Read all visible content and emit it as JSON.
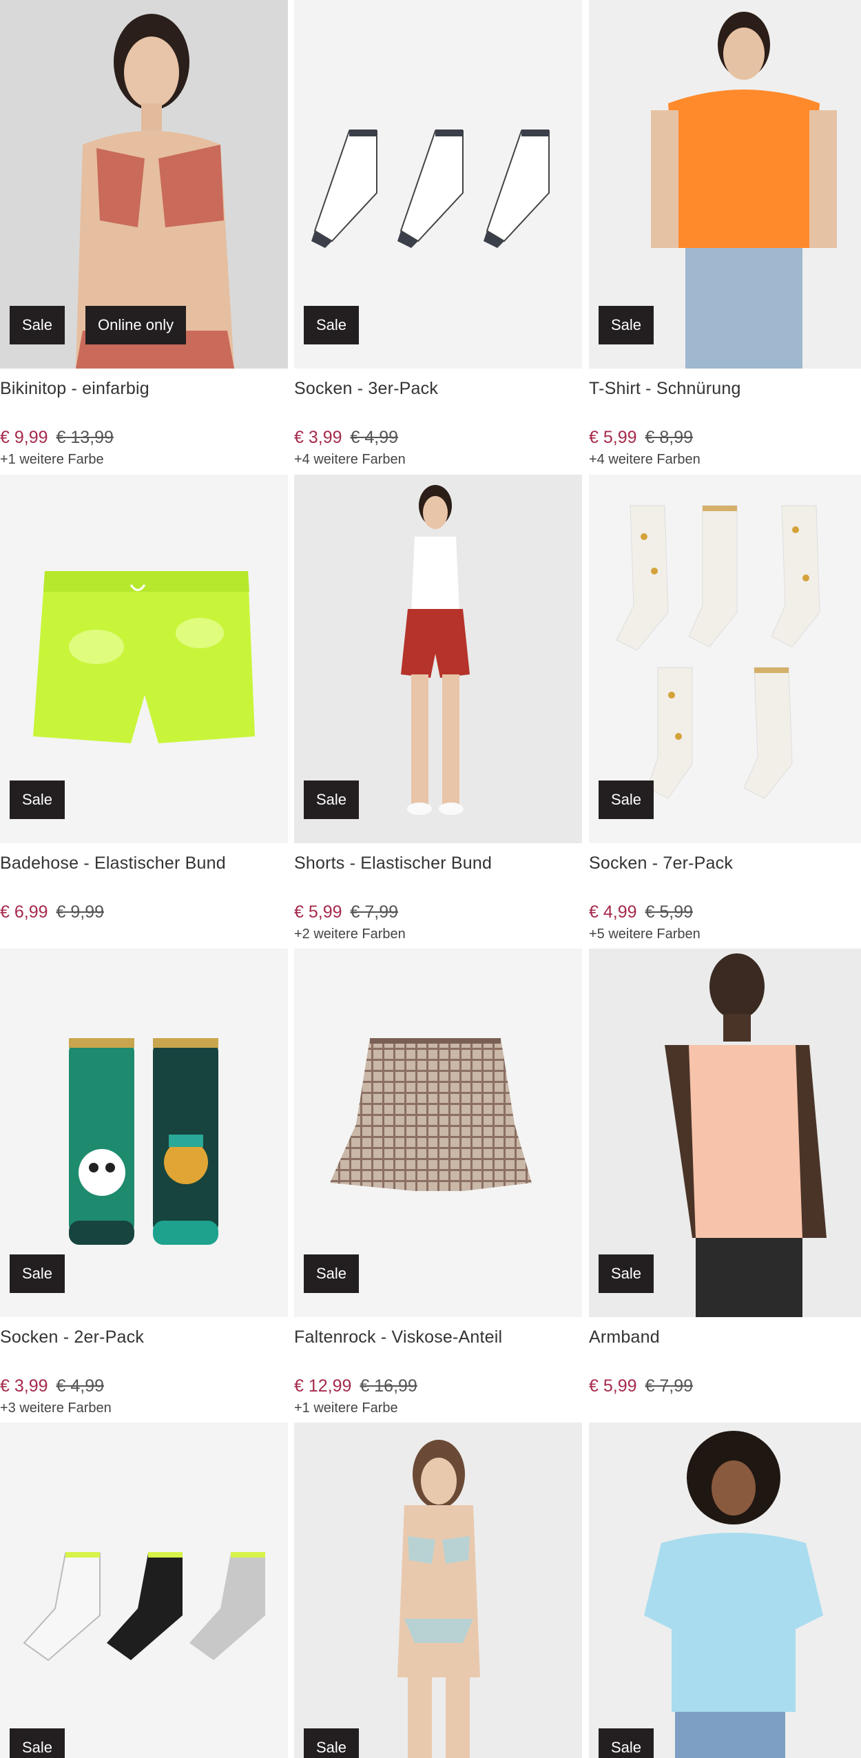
{
  "products": [
    {
      "title": "Bikinitop - einfarbig",
      "price": "€ 9,99",
      "old_price": "€ 13,99",
      "colors": "+1 weitere Farbe",
      "badges": [
        "Sale",
        "Online only"
      ],
      "image": "bikini-top-photo"
    },
    {
      "title": "Socken - 3er-Pack",
      "price": "€ 3,99",
      "old_price": "€ 4,99",
      "colors": "+4 weitere Farben",
      "badges": [
        "Sale"
      ],
      "image": "socks-3-pack-photo"
    },
    {
      "title": "T-Shirt - Schnürung",
      "price": "€ 5,99",
      "old_price": "€ 8,99",
      "colors": "+4 weitere Farben",
      "badges": [
        "Sale"
      ],
      "image": "orange-tshirt-photo"
    },
    {
      "title": "Badehose - Elastischer Bund",
      "price": "€ 6,99",
      "old_price": "€ 9,99",
      "colors": "",
      "badges": [
        "Sale"
      ],
      "image": "swim-shorts-photo"
    },
    {
      "title": "Shorts - Elastischer Bund",
      "price": "€ 5,99",
      "old_price": "€ 7,99",
      "colors": "+2 weitere Farben",
      "badges": [
        "Sale"
      ],
      "image": "red-shorts-photo"
    },
    {
      "title": "Socken - 7er-Pack",
      "price": "€ 4,99",
      "old_price": "€ 5,99",
      "colors": "+5 weitere Farben",
      "badges": [
        "Sale"
      ],
      "image": "star-socks-photo"
    },
    {
      "title": "Socken - 2er-Pack",
      "price": "€ 3,99",
      "old_price": "€ 4,99",
      "colors": "+3 weitere Farben",
      "badges": [
        "Sale"
      ],
      "image": "animal-socks-photo"
    },
    {
      "title": "Faltenrock - Viskose-Anteil",
      "price": "€ 12,99",
      "old_price": "€ 16,99",
      "colors": "+1 weitere Farbe",
      "badges": [
        "Sale"
      ],
      "image": "plaid-skirt-photo"
    },
    {
      "title": "Armband",
      "price": "€ 5,99",
      "old_price": "€ 7,99",
      "colors": "",
      "badges": [
        "Sale"
      ],
      "image": "tank-top-photo"
    },
    {
      "title": "",
      "price": "",
      "old_price": "",
      "colors": "",
      "badges": [
        "Sale"
      ],
      "image": "sport-socks-photo"
    },
    {
      "title": "",
      "price": "",
      "old_price": "",
      "colors": "",
      "badges": [
        "Sale"
      ],
      "image": "lingerie-set-photo"
    },
    {
      "title": "",
      "price": "",
      "old_price": "",
      "colors": "",
      "badges": [
        "Sale"
      ],
      "image": "blue-tshirt-photo"
    }
  ],
  "colors": {
    "sale_price": "#a52a4b",
    "badge_bg": "#231f20",
    "image_bg": "#f4f4f4"
  }
}
